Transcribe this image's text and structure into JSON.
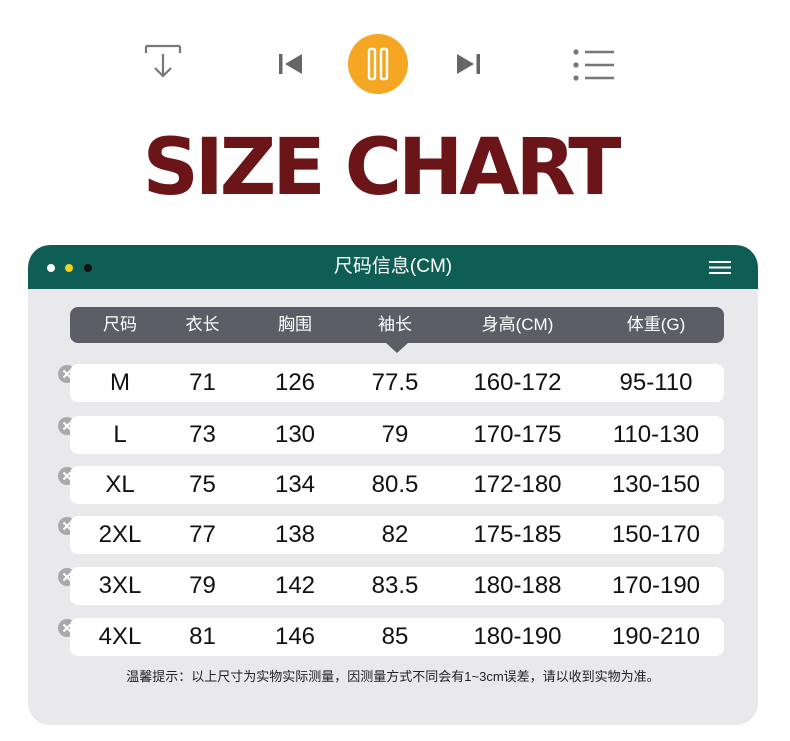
{
  "title": "SIZE CHART",
  "window": {
    "title": "尺码信息(CM)"
  },
  "columns": [
    "尺码",
    "衣长",
    "胸围",
    "袖长",
    "身高(CM)",
    "体重(G)"
  ],
  "rows": [
    [
      "M",
      "71",
      "126",
      "77.5",
      "160-172",
      "95-110"
    ],
    [
      "L",
      "73",
      "130",
      "79",
      "170-175",
      "110-130"
    ],
    [
      "XL",
      "75",
      "134",
      "80.5",
      "172-180",
      "130-150"
    ],
    [
      "2XL",
      "77",
      "138",
      "82",
      "175-185",
      "150-170"
    ],
    [
      "3XL",
      "79",
      "142",
      "83.5",
      "180-188",
      "170-190"
    ],
    [
      "4XL",
      "81",
      "146",
      "85",
      "180-190",
      "190-210"
    ]
  ],
  "note": "温馨提示：以上尺寸为实物实际测量，因测量方式不同会有1~3cm误差，请以收到实物为准。",
  "colors": {
    "title": "#6b1518",
    "titlebar": "#0f5e55",
    "header": "#5d5d66",
    "accent": "#f5a623",
    "card": "#e9e9eb"
  },
  "icons": [
    "download-icon",
    "skip-previous-icon",
    "pause-icon",
    "skip-next-icon",
    "playlist-icon",
    "hamburger-menu-icon",
    "close-circle-icon"
  ]
}
